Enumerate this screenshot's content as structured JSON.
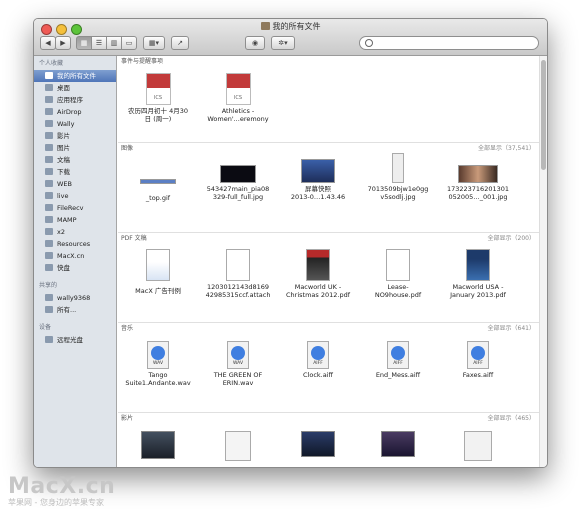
{
  "window": {
    "title": "我的所有文件"
  },
  "toolbar": {
    "nav_back": "◀",
    "nav_forward": "▶",
    "view_icon": "▦",
    "view_list": "☰",
    "view_column": "▥",
    "view_cover": "▭",
    "arrange": "▦▾",
    "share": "↗",
    "eye": "◉",
    "action": "✲▾",
    "search_placeholder": ""
  },
  "sidebar": {
    "favorites_header": "个人收藏",
    "favorites": [
      {
        "label": "我的所有文件",
        "icon": "all-files-icon"
      },
      {
        "label": "桌面",
        "icon": "desktop-icon"
      },
      {
        "label": "应用程序",
        "icon": "applications-icon"
      },
      {
        "label": "AirDrop",
        "icon": "airdrop-icon"
      },
      {
        "label": "Wally",
        "icon": "home-icon"
      },
      {
        "label": "影片",
        "icon": "movies-icon"
      },
      {
        "label": "图片",
        "icon": "pictures-icon"
      },
      {
        "label": "文稿",
        "icon": "documents-icon"
      },
      {
        "label": "下载",
        "icon": "downloads-icon"
      },
      {
        "label": "WEB",
        "icon": "folder-icon"
      },
      {
        "label": "live",
        "icon": "folder-icon"
      },
      {
        "label": "FileRecv",
        "icon": "folder-icon"
      },
      {
        "label": "MAMP",
        "icon": "folder-icon"
      },
      {
        "label": "x2",
        "icon": "folder-icon"
      },
      {
        "label": "Resources",
        "icon": "folder-icon"
      },
      {
        "label": "MacX.cn",
        "icon": "folder-icon"
      },
      {
        "label": "快盘",
        "icon": "folder-icon"
      }
    ],
    "shared_header": "共享的",
    "shared": [
      {
        "label": "wally9368",
        "icon": "computer-icon"
      },
      {
        "label": "所有...",
        "icon": "network-icon"
      }
    ],
    "devices_header": "设备",
    "devices": [
      {
        "label": "远程光盘",
        "icon": "remote-disc-icon"
      }
    ]
  },
  "sections": {
    "events": {
      "header": "事件与提醒事项",
      "items": [
        {
          "label1": "农历四月初十 4月30",
          "label2": "日 (周一)",
          "badge": "ICS"
        },
        {
          "label1": "Athletics -",
          "label2": "Women'...eremony",
          "badge": "ICS"
        }
      ]
    },
    "images": {
      "header": "图像",
      "show_all": "全部显示（37,541）",
      "items": [
        {
          "label1": "_top.gif",
          "label2": ""
        },
        {
          "label1": "543427main_pia08",
          "label2": "329-full_full.jpg"
        },
        {
          "label1": "屏幕快照",
          "label2": "2013-0…1.43.46"
        },
        {
          "label1": "7013509bjw1e0gg",
          "label2": "v5sodlj.jpg"
        },
        {
          "label1": "173223716201301",
          "label2": "052005…_001.jpg"
        }
      ]
    },
    "pdf": {
      "header": "PDF 文稿",
      "show_all": "全部显示（200）",
      "items": [
        {
          "label1": "MacX 广告刊例",
          "label2": ""
        },
        {
          "label1": "1203012143d8169",
          "label2": "42985315ccf.attach"
        },
        {
          "label1": "Macworld UK -",
          "label2": "Christmas 2012.pdf"
        },
        {
          "label1": "Lease-",
          "label2": "NO9house.pdf"
        },
        {
          "label1": "Macworld USA -",
          "label2": "January 2013.pdf"
        }
      ]
    },
    "music": {
      "header": "音乐",
      "show_all": "全部显示（641）",
      "items": [
        {
          "label1": "Tango",
          "label2": "Suite1.Andante.wav",
          "badge": "WAV"
        },
        {
          "label1": "THE GREEN OF",
          "label2": "ERIN.wav",
          "badge": "WAV"
        },
        {
          "label1": "Clock.aiff",
          "label2": "",
          "badge": "AIFF"
        },
        {
          "label1": "End_Mess.aiff",
          "label2": "",
          "badge": "AIFF"
        },
        {
          "label1": "Faxes.aiff",
          "label2": "",
          "badge": "AIFF"
        }
      ]
    },
    "movies": {
      "header": "影片",
      "show_all": "全部显示（465）"
    }
  },
  "watermark": {
    "main": "MacX.cn",
    "sub": "苹果网 - 您身边的苹果专家"
  }
}
